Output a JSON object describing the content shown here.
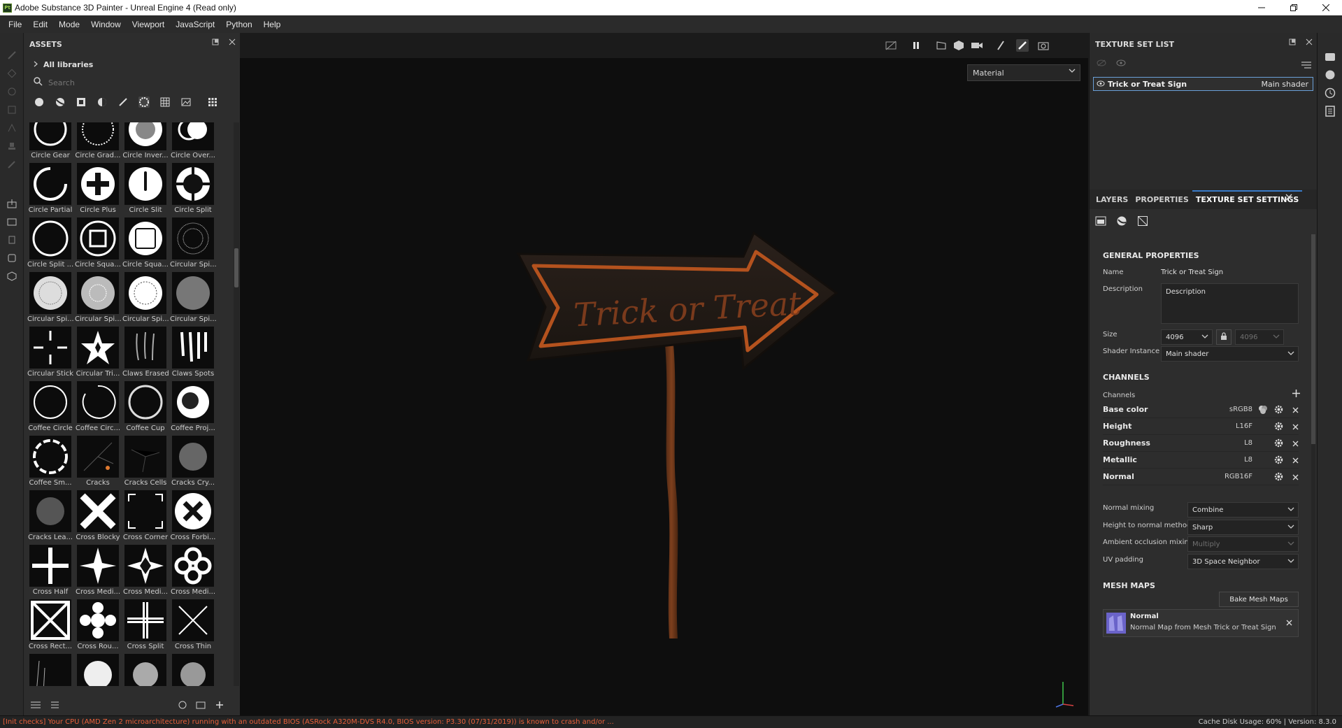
{
  "window": {
    "logo_text": "Pt",
    "title": "Adobe Substance 3D Painter - Unreal Engine 4 (Read only)",
    "controls": [
      "minimize",
      "restore",
      "close"
    ]
  },
  "menu": [
    "File",
    "Edit",
    "Mode",
    "Window",
    "Viewport",
    "JavaScript",
    "Python",
    "Help"
  ],
  "assets": {
    "title": "ASSETS",
    "all_libraries": "All libraries",
    "search_placeholder": "Search",
    "items": [
      "Circle Gear",
      "Circle Grad...",
      "Circle Inver...",
      "Circle Over...",
      "Circle Partial",
      "Circle Plus",
      "Circle Slit",
      "Circle Split",
      "Circle Split ...",
      "Circle Squa...",
      "Circle Squa...",
      "Circular Spi...",
      "Circular Spi...",
      "Circular Spi...",
      "Circular Spi...",
      "Circular Spi...",
      "Circular Stick",
      "Circular Tri...",
      "Claws Erased",
      "Claws Spots",
      "Coffee Circle",
      "Coffee Circ...",
      "Coffee Cup",
      "Coffee Proj...",
      "Coffee Sm...",
      "Cracks",
      "Cracks Cells",
      "Cracks Cry...",
      "Cracks Lea...",
      "Cross Blocky",
      "Cross Corner",
      "Cross Forbi...",
      "Cross Half",
      "Cross Medi...",
      "Cross Medi...",
      "Cross Medi...",
      "Cross Rect...",
      "Cross Rou...",
      "Cross Split",
      "Cross Thin",
      "",
      "",
      "",
      ""
    ]
  },
  "viewport": {
    "mode_select": "Material",
    "sign_text": "Trick or Treat"
  },
  "texture_set_list": {
    "title": "TEXTURE SET LIST",
    "item_name": "Trick or Treat Sign",
    "item_shader": "Main shader"
  },
  "properties": {
    "tabs": [
      "LAYERS",
      "PROPERTIES",
      "TEXTURE SET SETTINGS"
    ],
    "general_title": "GENERAL PROPERTIES",
    "name_label": "Name",
    "name_value": "Trick or Treat Sign",
    "description_label": "Description",
    "description_value": "Description",
    "size_label": "Size",
    "size_value": "4096",
    "size_value_locked": "4096",
    "shader_instance_label": "Shader Instance",
    "shader_instance_value": "Main shader",
    "channels_title": "CHANNELS",
    "channels_label": "Channels",
    "channels": [
      {
        "name": "Base color",
        "format": "sRGB8"
      },
      {
        "name": "Height",
        "format": "L16F"
      },
      {
        "name": "Roughness",
        "format": "L8"
      },
      {
        "name": "Metallic",
        "format": "L8"
      },
      {
        "name": "Normal",
        "format": "RGB16F"
      }
    ],
    "normal_mixing_label": "Normal mixing",
    "normal_mixing_value": "Combine",
    "height_to_normal_label": "Height to normal method",
    "height_to_normal_value": "Sharp",
    "ao_mixing_label": "Ambient occlusion mixing",
    "ao_mixing_value": "Multiply",
    "uv_padding_label": "UV padding",
    "uv_padding_value": "3D Space Neighbor",
    "mesh_maps_title": "MESH MAPS",
    "bake_button": "Bake Mesh Maps",
    "mesh_map_name": "Normal",
    "mesh_map_desc": "Normal Map from Mesh Trick or Treat Sign"
  },
  "status": {
    "message": "[Init checks] Your CPU (AMD Zen 2 microarchitecture) running with an outdated BIOS (ASRock A320M-DVS R4.0, BIOS version: P3.30 (07/31/2019)) is known to crash and/or ...",
    "cache": "Cache Disk Usage:   60% | Version: 8.3.0"
  },
  "colors": {
    "accent": "#3a7bc8",
    "warning": "#e8603a",
    "sign_outline": "#b4521e"
  }
}
